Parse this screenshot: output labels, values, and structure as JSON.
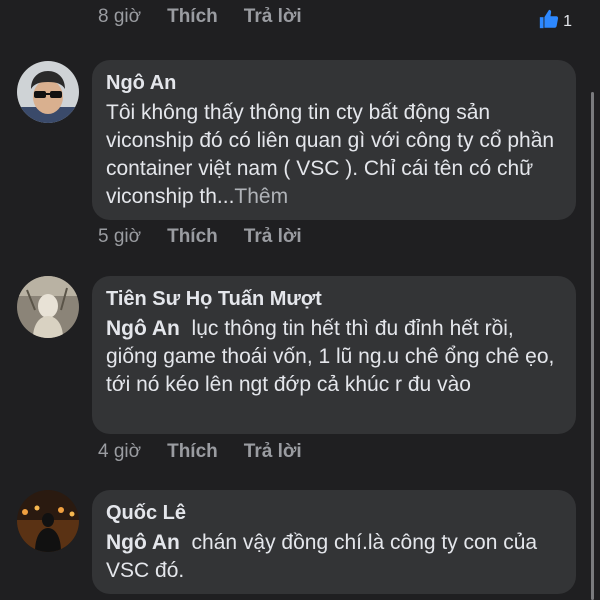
{
  "top_row": {
    "time": "8 giờ",
    "like_label": "Thích",
    "reply_label": "Trả lời",
    "reaction_count": "1"
  },
  "comments": [
    {
      "author": "Ngô An",
      "text": "Tôi không thấy thông tin cty bất động sản viconship đó có liên quan gì với công ty cổ phần container việt nam ( VSC ). Chỉ cái tên có chữ viconship th...",
      "more_label": "Thêm",
      "time": "5 giờ",
      "like_label": "Thích",
      "reply_label": "Trả lời"
    },
    {
      "author": "Tiên Sư Họ Tuấn Mượt",
      "mention": "Ngô An",
      "text": "lục thông tin hết thì đu đỉnh hết rồi, giống game thoái vốn, 1 lũ ng.u chê ổng chê ẹo, tới nó kéo lên ngt đớp cả khúc r đu vào",
      "time": "4 giờ",
      "like_label": "Thích",
      "reply_label": "Trả lời"
    },
    {
      "author": "Quốc Lê",
      "mention": "Ngô An",
      "text": "chán vậy đồng chí.là công ty con của VSC đó."
    }
  ],
  "colors": {
    "background": "#1f1f21",
    "bubble": "#333436",
    "meta_text": "#9a9ca1",
    "like_blue": "#2d88ff"
  },
  "icons": {
    "reaction": "thumbs-up-icon"
  }
}
